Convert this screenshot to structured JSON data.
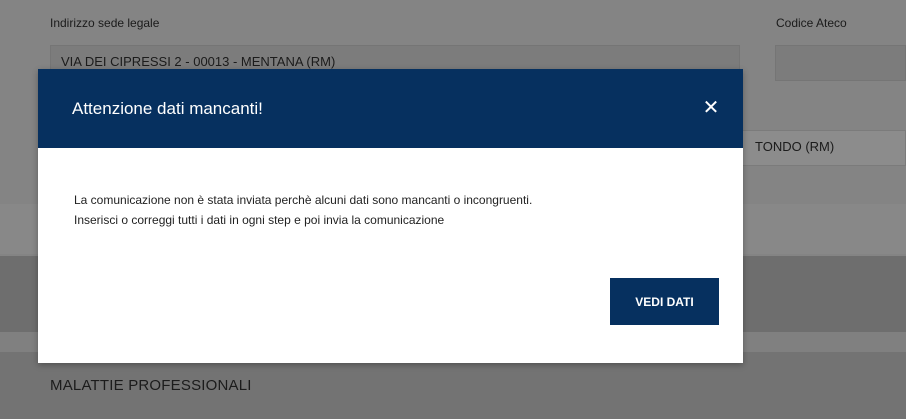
{
  "background": {
    "address_label": "Indirizzo sede legale",
    "address_value": "VIA DEI CIPRESSI 2 - 00013 - MENTANA (RM)",
    "ateco_label": "Codice Ateco",
    "ateco_value": "",
    "right_field_value": "TONDO (RM)",
    "section_title": "MALATTIE PROFESSIONALI"
  },
  "modal": {
    "title": "Attenzione dati mancanti!",
    "close_glyph": "✕",
    "message_line1": "La comunicazione non è stata inviata perchè alcuni dati sono mancanti o incongruenti.",
    "message_line2": "Inserisci o correggi tutti i dati in ogni step e poi invia la comunicazione",
    "button_label": "VEDI DATI"
  },
  "colors": {
    "modal_header": "#06305f",
    "button": "#06305f"
  },
  "icons": {
    "close": "close-icon"
  }
}
